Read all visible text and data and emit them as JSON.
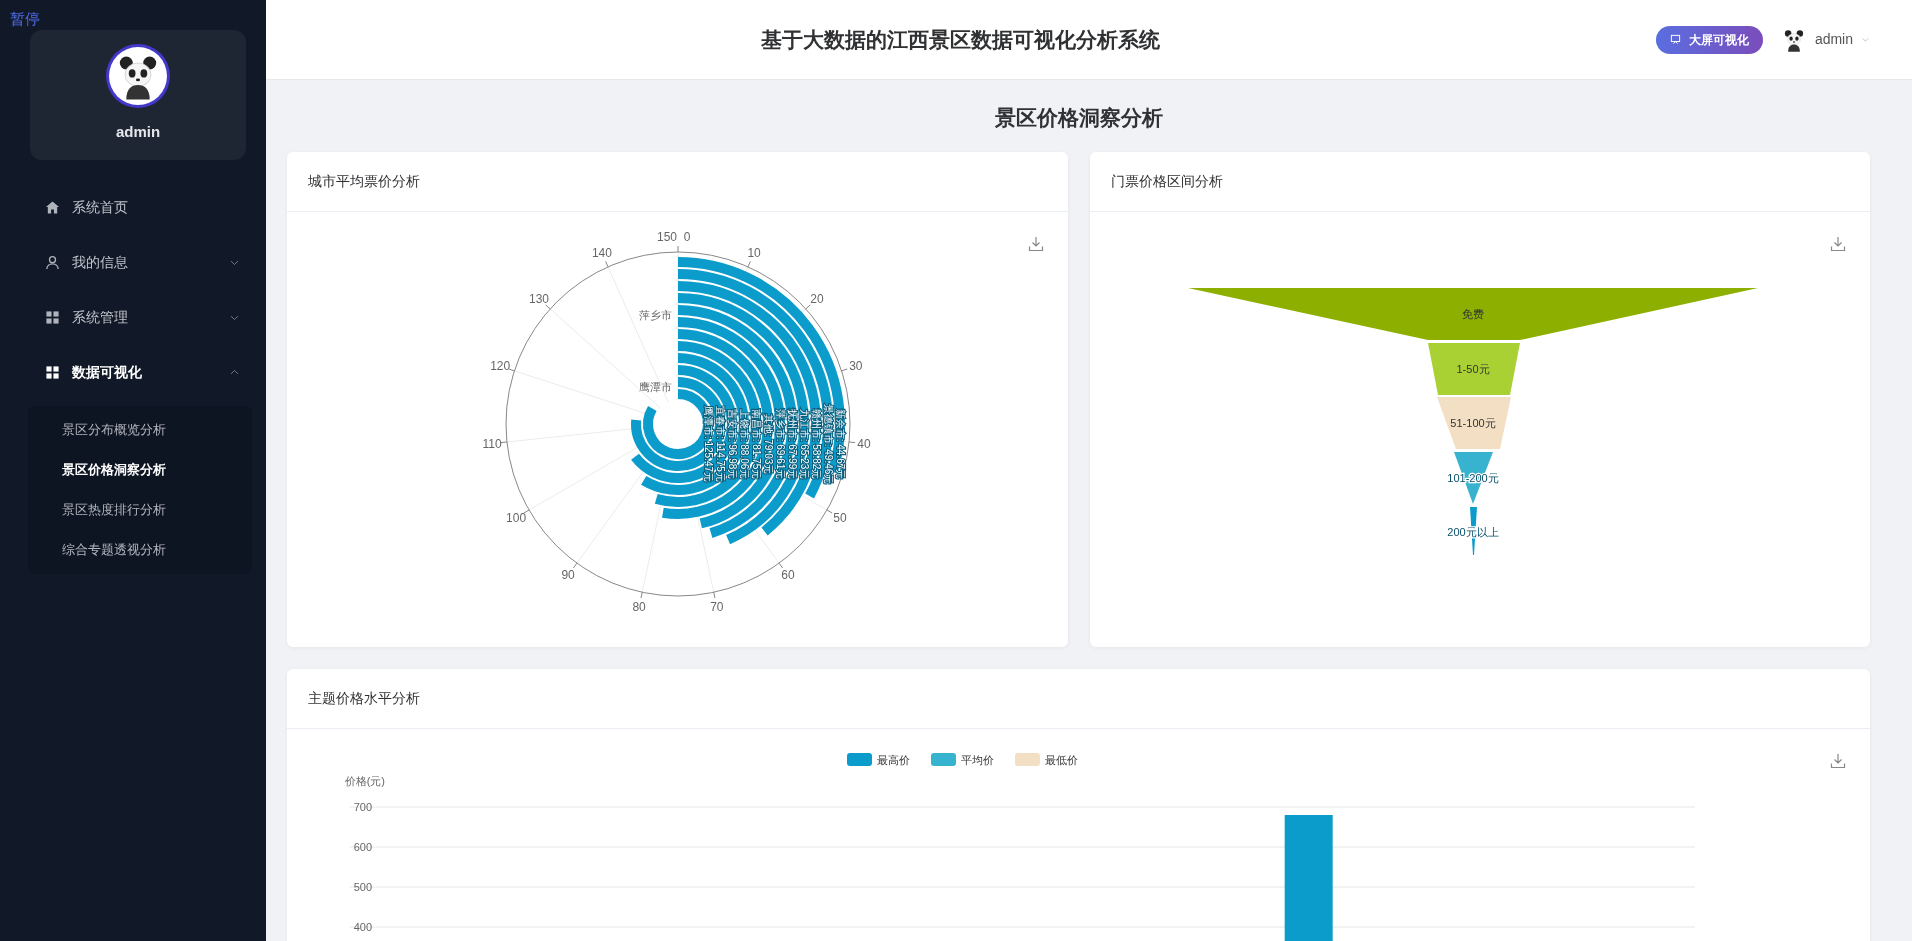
{
  "overlay_label": "暂停",
  "sidebar": {
    "profile": {
      "name": "admin"
    },
    "menu": [
      {
        "label": "系统首页",
        "kind": "link"
      },
      {
        "label": "我的信息",
        "kind": "group",
        "expanded": false
      },
      {
        "label": "系统管理",
        "kind": "group",
        "expanded": false
      },
      {
        "label": "数据可视化",
        "kind": "group",
        "expanded": true,
        "children": [
          {
            "label": "景区分布概览分析",
            "selected": false
          },
          {
            "label": "景区价格洞察分析",
            "selected": true
          },
          {
            "label": "景区热度排行分析",
            "selected": false
          },
          {
            "label": "综合专题透视分析",
            "selected": false
          }
        ]
      }
    ]
  },
  "header": {
    "title": "基于大数据的江西景区数据可视化分析系统",
    "screen_button": "大屏可视化",
    "user": "admin"
  },
  "page_title": "景区价格洞察分析",
  "city_price_card": {
    "title": "城市平均票价分析",
    "polar_chart": {
      "angle_labels": [
        "0",
        "10",
        "20",
        "30",
        "40",
        "50",
        "60",
        "70",
        "80",
        "90",
        "100",
        "110",
        "120",
        "130",
        "140",
        "150"
      ],
      "radial_axis_labels": [
        "萍乡市",
        "鹰潭市"
      ],
      "bar_labels": [
        "鹰潭市: 125.47元",
        "宜春市: 114.75元",
        "吉安市: 96.98元",
        "上饶市: 88.06元",
        "南昌市: 81.75元",
        "其他: 79.03元",
        "萍乡市: 69.61元",
        "抚州市: 67.99元",
        "九江市: 65.23元",
        "赣州市: 58.82元",
        "景德镇市: 49.46元",
        "新余市: 44.67元"
      ]
    }
  },
  "price_range_card": {
    "title": "门票价格区间分析",
    "segments": [
      {
        "label": "免费",
        "color": "#8db000"
      },
      {
        "label": "1-50元",
        "color": "#a9d134"
      },
      {
        "label": "51-100元",
        "color": "#f2dfc4"
      },
      {
        "label": "101-200元",
        "color": "#38b3cf"
      },
      {
        "label": "200元以上",
        "color": "#0b9ccb"
      }
    ]
  },
  "theme_price_card": {
    "title": "主题价格水平分析",
    "chart_data": {
      "type": "bar",
      "ylabel": "价格(元)",
      "yticks": [
        400,
        500,
        600,
        700
      ],
      "ylim": [
        0,
        700
      ],
      "grid": true,
      "series": [
        {
          "name": "最高价",
          "color": "#0b9ccb",
          "values": [
            null,
            null,
            null,
            null,
            null,
            680,
            null,
            null
          ]
        },
        {
          "name": "平均价",
          "color": "#38b3cf",
          "values": [
            null,
            null,
            null,
            null,
            null,
            null,
            null,
            null
          ]
        },
        {
          "name": "最低价",
          "color": "#f2dfc4",
          "values": [
            null,
            null,
            null,
            null,
            null,
            null,
            null,
            null
          ]
        }
      ]
    }
  }
}
